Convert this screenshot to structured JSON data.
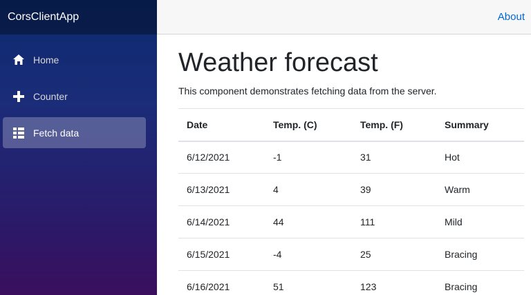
{
  "sidebar": {
    "brand": "CorsClientApp",
    "items": [
      {
        "label": "Home",
        "icon": "home-icon",
        "active": false
      },
      {
        "label": "Counter",
        "icon": "plus-icon",
        "active": false
      },
      {
        "label": "Fetch data",
        "icon": "list-icon",
        "active": true
      }
    ]
  },
  "header": {
    "about_label": "About"
  },
  "main": {
    "title": "Weather forecast",
    "intro": "This component demonstrates fetching data from the server.",
    "table": {
      "headers": [
        "Date",
        "Temp. (C)",
        "Temp. (F)",
        "Summary"
      ],
      "rows": [
        [
          "6/12/2021",
          "-1",
          "31",
          "Hot"
        ],
        [
          "6/13/2021",
          "4",
          "39",
          "Warm"
        ],
        [
          "6/14/2021",
          "44",
          "111",
          "Mild"
        ],
        [
          "6/15/2021",
          "-4",
          "25",
          "Bracing"
        ],
        [
          "6/16/2021",
          "51",
          "123",
          "Bracing"
        ]
      ]
    }
  },
  "colors": {
    "link": "#0366d6",
    "sidebar_top": "#0b2a6f",
    "sidebar_bottom": "#3a0f5e"
  }
}
